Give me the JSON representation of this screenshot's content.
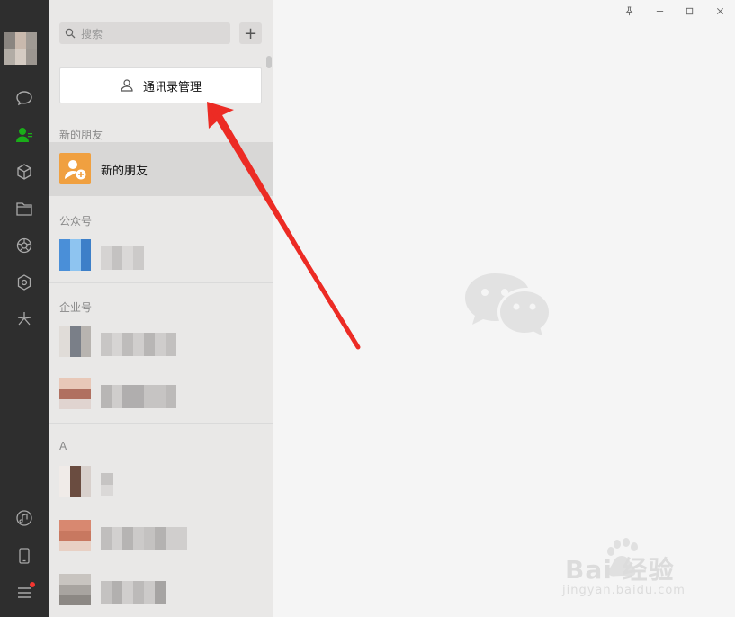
{
  "search": {
    "placeholder": "搜索"
  },
  "toolbar": {
    "add_label": "+"
  },
  "contacts": {
    "manage_button_label": "通讯录管理",
    "sections": {
      "new_friends": "新的朋友",
      "official_accounts": "公众号",
      "enterprise": "企业号",
      "a_group": "A"
    },
    "new_friend_row_label": "新的朋友"
  },
  "window": {
    "pin": "📌",
    "minimize": "—",
    "maximize": "□",
    "close": "✕"
  },
  "watermark": {
    "brand": "Bai 经验",
    "url": "jingyan.baidu.com"
  },
  "colors": {
    "accent": "#1aad19",
    "arrow": "#ec2b24",
    "new_friend_avatar": "#f0a040"
  },
  "icons": [
    "chat-icon",
    "contacts-icon",
    "cube-icon",
    "folder-icon",
    "aperture-icon",
    "hexagon-icon",
    "sparkle-icon",
    "music-icon",
    "phone-icon",
    "menu-icon"
  ]
}
